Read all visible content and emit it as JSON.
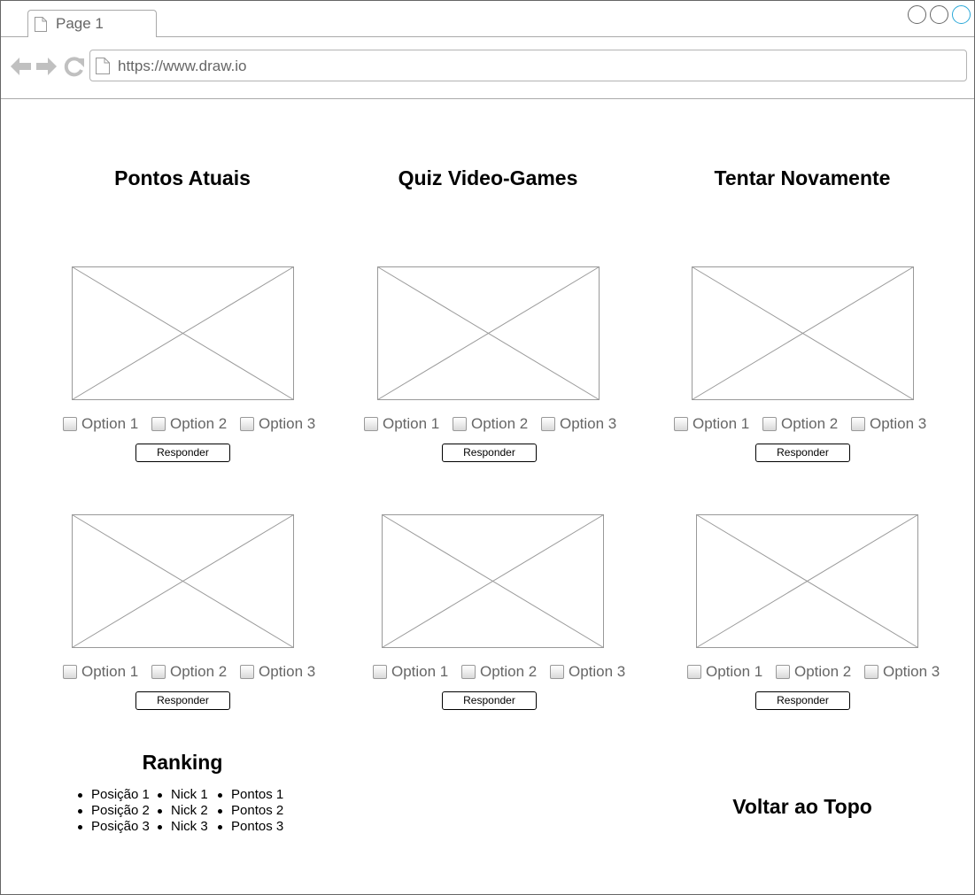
{
  "browser": {
    "tab_label": "Page 1",
    "url": "https://www.draw.io"
  },
  "headings": {
    "current_points": "Pontos Atuais",
    "quiz_title": "Quiz Video-Games",
    "try_again": "Tentar Novamente",
    "ranking": "Ranking",
    "back_to_top": "Voltar ao Topo"
  },
  "quiz": {
    "options": [
      "Option 1",
      "Option 2",
      "Option 3"
    ],
    "respond_label": "Responder"
  },
  "ranking": {
    "positions": [
      "Posição 1",
      "Posição 2",
      "Posição 3"
    ],
    "nicks": [
      "Nick 1",
      "Nick 2",
      "Nick 3"
    ],
    "points": [
      "Pontos 1",
      "Pontos 2",
      "Pontos 3"
    ]
  },
  "colors": {
    "border": "#666666",
    "placeholder_stroke": "#999999",
    "muted_text": "#666666",
    "maximize_accent": "#2aa8d8"
  }
}
